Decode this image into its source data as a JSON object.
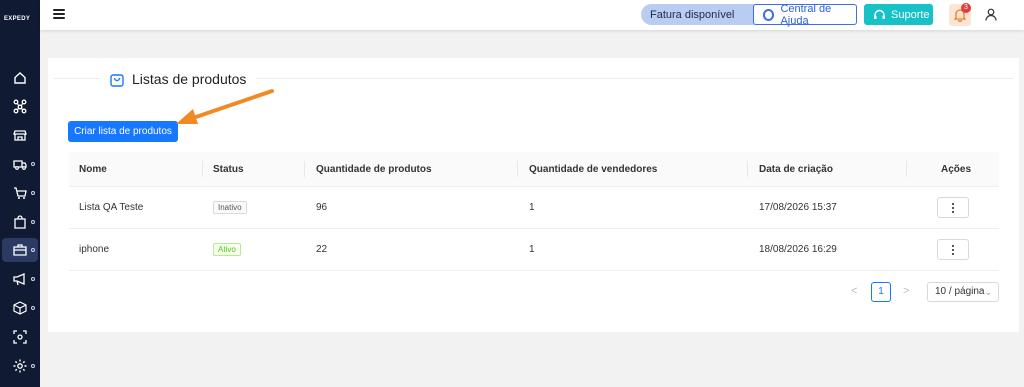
{
  "app": {
    "logo": "EXPEDY"
  },
  "header": {
    "fatura_label": "Fatura disponível",
    "ajuda_label": "Central de Ajuda",
    "suporte_label": "Suporte",
    "notification_count": "3"
  },
  "sidebar": {
    "items": [
      {
        "icon": "home-icon"
      },
      {
        "icon": "network-icon"
      },
      {
        "icon": "store-icon"
      },
      {
        "icon": "truck-icon"
      },
      {
        "icon": "cart-icon"
      },
      {
        "icon": "shopping-bag-icon"
      },
      {
        "icon": "briefcase-icon",
        "active": true
      },
      {
        "icon": "megaphone-icon"
      },
      {
        "icon": "cube-icon"
      },
      {
        "icon": "scan-icon"
      },
      {
        "icon": "settings-icon"
      }
    ]
  },
  "page": {
    "title": "Listas de produtos",
    "create_button": "Criar lista de produtos"
  },
  "table": {
    "columns": [
      "Nome",
      "Status",
      "Quantidade de produtos",
      "Quantidade de vendedores",
      "Data de criação",
      "Ações"
    ],
    "rows": [
      {
        "nome": "Lista QA Teste",
        "status": "Inativo",
        "produtos": "96",
        "vendedores": "1",
        "data": "17/08/2026 15:37"
      },
      {
        "nome": "iphone",
        "status": "Ativo",
        "produtos": "22",
        "vendedores": "1",
        "data": "18/08/2026 16:29"
      }
    ]
  },
  "pagination": {
    "prev": "<",
    "current_page": "1",
    "next": ">",
    "page_size": "10 / página"
  },
  "colors": {
    "sidebar_bg": "#111a33",
    "primary": "#1677ff",
    "suporte": "#16c1c7",
    "arrow": "#f08a24"
  }
}
